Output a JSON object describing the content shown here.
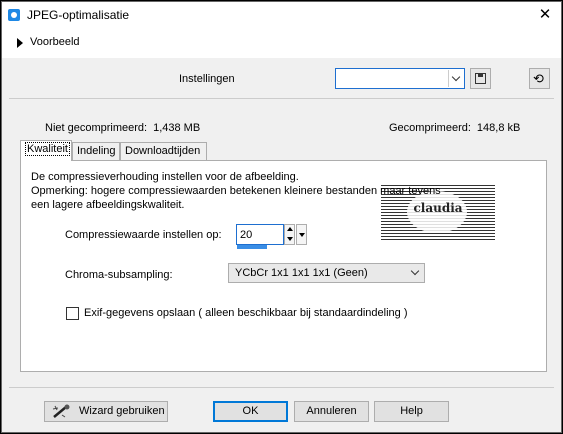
{
  "window": {
    "title": "JPEG-optimalisatie",
    "close": "✕"
  },
  "preview": {
    "label": "Voorbeeld"
  },
  "settings": {
    "label": "Instellingen",
    "preset_value": ""
  },
  "sizes": {
    "uncompressed_label": "Niet gecomprimeerd:",
    "uncompressed_value": "1,438 MB",
    "compressed_label": "Gecomprimeerd:",
    "compressed_value": "148,8 kB"
  },
  "tabs": [
    {
      "label": "Kwaliteit"
    },
    {
      "label": "Indeling"
    },
    {
      "label": "Downloadtijden"
    }
  ],
  "quality": {
    "desc1": "De compressieverhouding instellen voor de afbeelding.",
    "desc2": "Opmerking:  hogere compressiewaarden betekenen kleinere bestanden maar tevens",
    "desc3": "een lagere afbeeldingskwaliteit.",
    "compression_label": "Compressiewaarde instellen op:",
    "compression_value": "20",
    "compression_fraction": 0.2,
    "chroma_label": "Chroma-subsampling:",
    "chroma_value": "YCbCr  1x1  1x1  1x1  (Geen)",
    "exif_label": "Exif-gegevens opslaan ( alleen beschikbaar bij standaardindeling )",
    "exif_checked": false
  },
  "watermark": {
    "text": "claudia"
  },
  "buttons": {
    "wizard": "Wizard gebruiken",
    "ok": "OK",
    "cancel": "Annuleren",
    "help": "Help"
  },
  "colors": {
    "accent": "#0078d7",
    "progress": "#3a8ee6",
    "app_icon": "#1e88e5"
  }
}
